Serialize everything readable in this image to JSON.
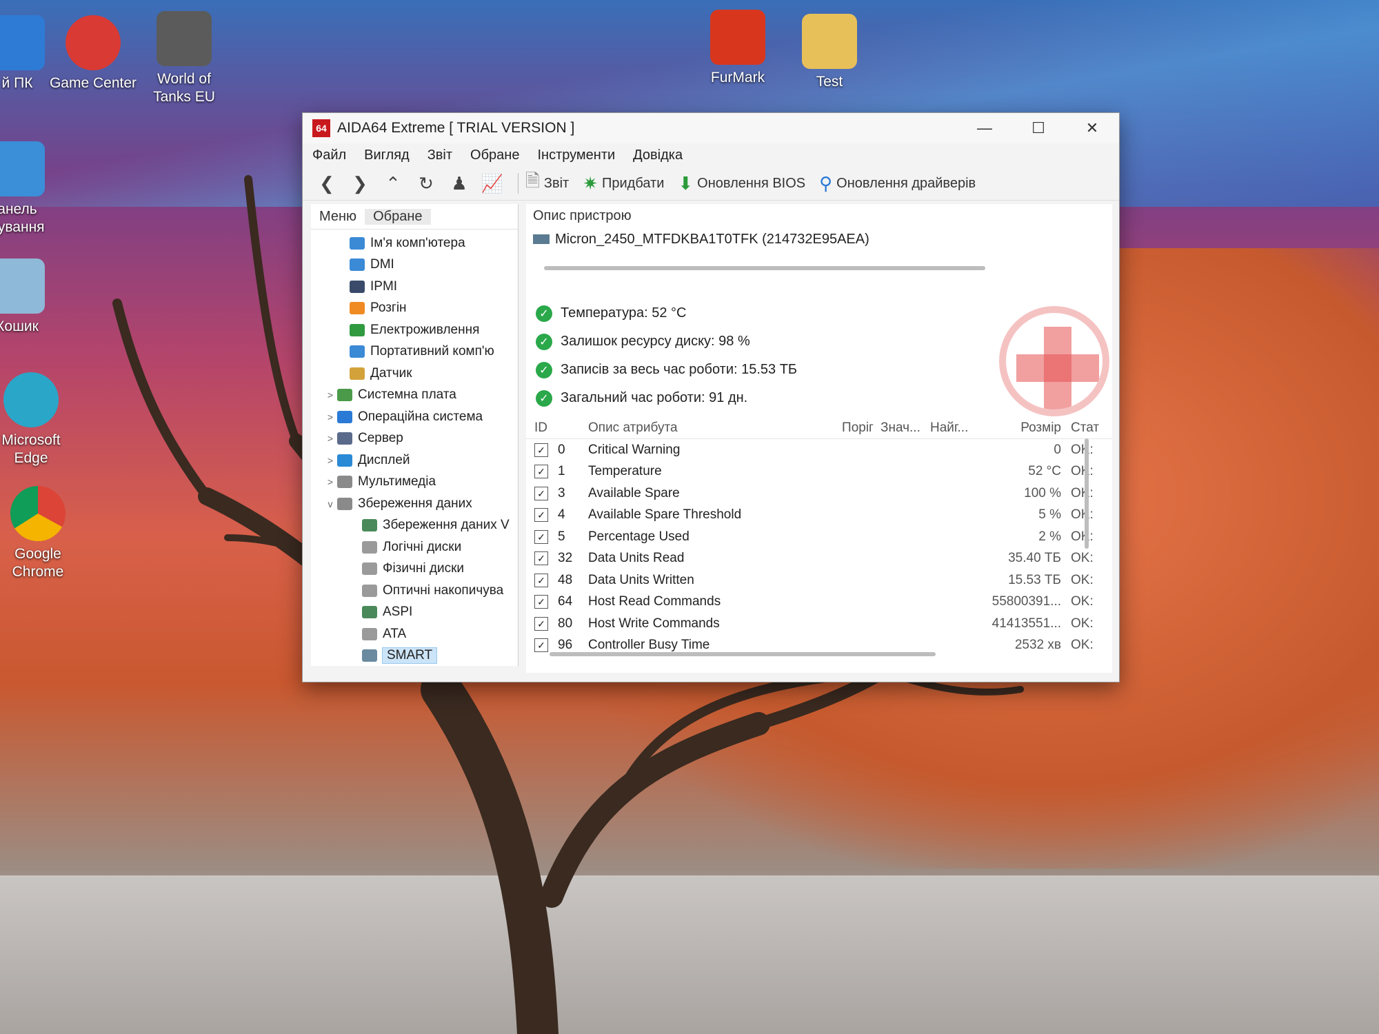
{
  "desktop": {
    "icons": [
      {
        "label": "й ПК",
        "color": "#2e7bd6"
      },
      {
        "label": "Game Center",
        "color": "#d93a34"
      },
      {
        "label": "World of Tanks EU",
        "color": "#5b5b5b"
      },
      {
        "label": "FurMark",
        "color": "#d8371e"
      },
      {
        "label": "Test",
        "color": "#e8c05a"
      },
      {
        "label": "анель рування",
        "color": "#3a8fd8"
      },
      {
        "label": "Кошик",
        "color": "#8fb9d8"
      },
      {
        "label": "Microsoft Edge",
        "color": "#2aa6c8"
      },
      {
        "label": "Google Chrome",
        "color": "#e0b020"
      }
    ]
  },
  "window": {
    "logo": "64",
    "title": "AIDA64 Extreme  [ TRIAL VERSION ]",
    "controls": {
      "minimize": "—",
      "maximize": "☐",
      "close": "✕"
    }
  },
  "menu": [
    "Файл",
    "Вигляд",
    "Звіт",
    "Обране",
    "Інструменти",
    "Довідка"
  ],
  "toolbar": {
    "report": "Звіт",
    "buy": "Придбати",
    "bios_update": "Оновлення BIOS",
    "driver_update": "Оновлення драйверів"
  },
  "leftpane": {
    "tabs": [
      "Меню",
      "Обране"
    ],
    "items": [
      {
        "label": "Ім'я комп'ютера",
        "indent": 2,
        "expander": "",
        "color": "#3b8ad6"
      },
      {
        "label": "DMI",
        "indent": 2,
        "expander": "",
        "color": "#3b8ad6"
      },
      {
        "label": "IPMI",
        "indent": 2,
        "expander": "",
        "color": "#3a4a6a"
      },
      {
        "label": "Розгін",
        "indent": 2,
        "expander": "",
        "color": "#f08a22"
      },
      {
        "label": "Електроживлення",
        "indent": 2,
        "expander": "",
        "color": "#2f9a40"
      },
      {
        "label": "Портативний комп'ю",
        "indent": 2,
        "expander": "",
        "color": "#3b8ad6"
      },
      {
        "label": "Датчик",
        "indent": 2,
        "expander": "",
        "color": "#d3a23a"
      },
      {
        "label": "Системна плата",
        "indent": 1,
        "expander": ">",
        "color": "#4a9a4a"
      },
      {
        "label": "Операційна система",
        "indent": 1,
        "expander": ">",
        "color": "#2a7ad6"
      },
      {
        "label": "Сервер",
        "indent": 1,
        "expander": ">",
        "color": "#5a6a8a"
      },
      {
        "label": "Дисплей",
        "indent": 1,
        "expander": ">",
        "color": "#2a8ad6"
      },
      {
        "label": "Мультимедіа",
        "indent": 1,
        "expander": ">",
        "color": "#8a8a8a"
      },
      {
        "label": "Збереження даних",
        "indent": 1,
        "expander": "v",
        "color": "#8a8a8a"
      },
      {
        "label": "Збереження даних V",
        "indent": 3,
        "expander": "",
        "color": "#4a8a5a"
      },
      {
        "label": "Логічні диски",
        "indent": 3,
        "expander": "",
        "color": "#9a9a9a"
      },
      {
        "label": "Фізичні диски",
        "indent": 3,
        "expander": "",
        "color": "#9a9a9a"
      },
      {
        "label": "Оптичні накопичува",
        "indent": 3,
        "expander": "",
        "color": "#9a9a9a"
      },
      {
        "label": "ASPI",
        "indent": 3,
        "expander": "",
        "color": "#4a8a5a"
      },
      {
        "label": "ATA",
        "indent": 3,
        "expander": "",
        "color": "#9a9a9a"
      },
      {
        "label": "SMART",
        "indent": 3,
        "expander": "",
        "color": "#6a8aa0",
        "selected": true
      }
    ]
  },
  "device": {
    "header": "Опис пристрою",
    "name": "Micron_2450_MTFDKBA1T0TFK (214732E95AEA)"
  },
  "status": [
    "Температура: 52 °C",
    "Залишок ресурсу диску: 98 %",
    "Записів за весь час роботи: 15.53 ТБ",
    "Загальний час роботи: 91 дн."
  ],
  "smart_table": {
    "headers": {
      "id": "ID",
      "desc": "Опис атрибута",
      "thr": "Поріг",
      "val": "Знач...",
      "worst": "Найг...",
      "raw": "Розмір",
      "status": "Стат"
    },
    "rows": [
      {
        "id": "0",
        "desc": "Critical Warning",
        "raw": "0",
        "status": "OK:"
      },
      {
        "id": "1",
        "desc": "Temperature",
        "raw": "52 °C",
        "status": "OK:"
      },
      {
        "id": "3",
        "desc": "Available Spare",
        "raw": "100 %",
        "status": "OK:"
      },
      {
        "id": "4",
        "desc": "Available Spare Threshold",
        "raw": "5 %",
        "status": "OK:"
      },
      {
        "id": "5",
        "desc": "Percentage Used",
        "raw": "2 %",
        "status": "OK:"
      },
      {
        "id": "32",
        "desc": "Data Units Read",
        "raw": "35.40 ТБ",
        "status": "OK:"
      },
      {
        "id": "48",
        "desc": "Data Units Written",
        "raw": "15.53 ТБ",
        "status": "OK:"
      },
      {
        "id": "64",
        "desc": "Host Read Commands",
        "raw": "55800391...",
        "status": "OK:"
      },
      {
        "id": "80",
        "desc": "Host Write Commands",
        "raw": "41413551...",
        "status": "OK:"
      },
      {
        "id": "96",
        "desc": "Controller Busy Time",
        "raw": "2532 хв",
        "status": "OK:"
      }
    ]
  }
}
